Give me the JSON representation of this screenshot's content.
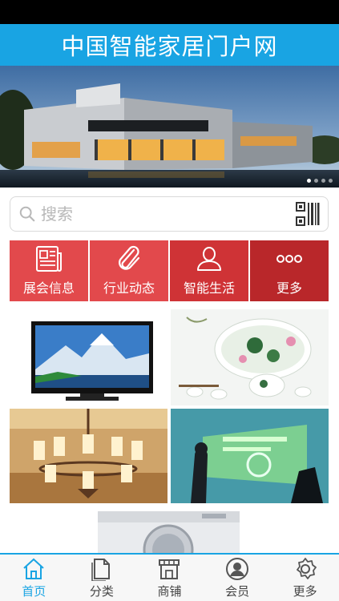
{
  "header": {
    "title": "中国智能家居门户网"
  },
  "banner": {
    "slide_count": 4,
    "active_slide": 1
  },
  "search": {
    "placeholder": "搜索"
  },
  "nav_tiles": [
    {
      "label": "展会信息",
      "icon": "newspaper-icon",
      "color": "#e2494c"
    },
    {
      "label": "行业动态",
      "icon": "paperclip-icon",
      "color": "#e2494c"
    },
    {
      "label": "智能生活",
      "icon": "user-outline-icon",
      "color": "#cf3336"
    },
    {
      "label": "更多",
      "icon": "more-dots-icon",
      "color": "#b9272a"
    }
  ],
  "products": [
    {
      "name": "tv",
      "icon": "television-image"
    },
    {
      "name": "tea-set",
      "icon": "tea-set-image"
    },
    {
      "name": "chandelier",
      "icon": "chandelier-image"
    },
    {
      "name": "smart-screen",
      "icon": "touchscreen-image"
    },
    {
      "name": "washing-machine",
      "icon": "washing-machine-image"
    }
  ],
  "bottom_nav": [
    {
      "label": "首页",
      "icon": "home-icon",
      "active": true
    },
    {
      "label": "分类",
      "icon": "category-icon",
      "active": false
    },
    {
      "label": "商铺",
      "icon": "shop-icon",
      "active": false
    },
    {
      "label": "会员",
      "icon": "member-icon",
      "active": false
    },
    {
      "label": "更多",
      "icon": "settings-gear-icon",
      "active": false
    }
  ],
  "colors": {
    "accent": "#19a4e3",
    "tile_red": "#e2494c",
    "tile_dark_red": "#b9272a"
  }
}
